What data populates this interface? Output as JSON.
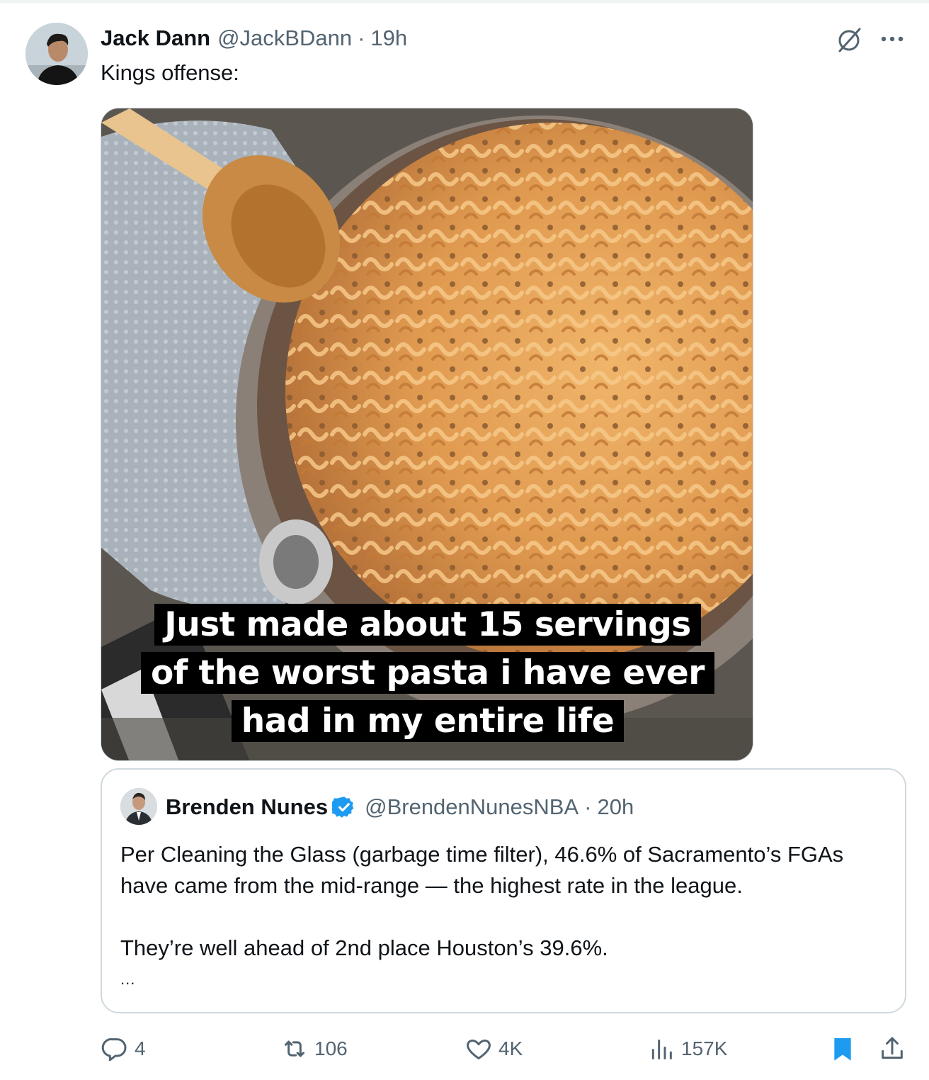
{
  "tweet": {
    "author_name": "Jack Dann",
    "author_handle": "@JackBDann",
    "separator": "·",
    "time": "19h",
    "text": "Kings offense:",
    "media": {
      "caption_lines": [
        "Just made about 15 servings",
        "of the worst pasta i have ever",
        "had in my entire life"
      ]
    }
  },
  "quote": {
    "author_name": "Brenden Nunes",
    "author_handle": "@BrendenNunesNBA",
    "separator": "·",
    "time": "20h",
    "verified": true,
    "paragraphs": [
      "Per Cleaning the Glass (garbage time filter), 46.6% of Sacramento’s FGAs have came from the mid-range — the highest rate in the league.",
      "They’re well ahead of 2nd place Houston’s 39.6%.",
      "..."
    ]
  },
  "actions": {
    "replies": "4",
    "reposts": "106",
    "likes": "4K",
    "views": "157K"
  },
  "icons": {
    "grok": "grok-icon",
    "more": "more-icon",
    "reply": "reply-icon",
    "repost": "repost-icon",
    "like": "heart-icon",
    "views": "views-icon",
    "bookmark": "bookmark-icon",
    "share": "share-icon",
    "verified": "verified-badge-icon"
  },
  "colors": {
    "text_primary": "#0f1419",
    "text_secondary": "#536471",
    "border": "#cfd9de",
    "accent_blue": "#1d9bf0"
  }
}
